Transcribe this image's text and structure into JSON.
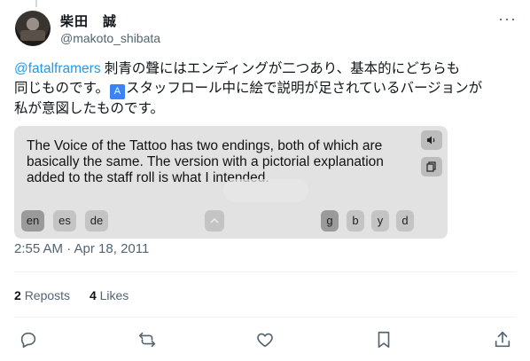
{
  "author": {
    "name": "柴田　誠",
    "handle": "@makoto_shibata"
  },
  "tweet": {
    "mention": "@fatalframers",
    "text_line1": " 刺青の聲にはエンディングが二つあり、基本的にどちらも",
    "text_line2a": "同じものです。",
    "text_line2b": "スタッフロール中に絵で説明が足されているバージョンが",
    "text_line3": "私が意図したものです。"
  },
  "translation": {
    "text": "The Voice of the Tattoo has two endings, both of which are basically the same. The version with a pictorial explanation added to the staff roll is what I intended.",
    "languages": [
      "en",
      "es",
      "de"
    ],
    "active_language": "en",
    "engines": [
      "g",
      "b",
      "y",
      "d"
    ],
    "active_engine": "g",
    "speak_icon": "speaker-icon",
    "copy_icon": "copy-icon",
    "collapse_icon": "chevron-up-icon"
  },
  "meta": {
    "timestamp": "2:55 AM · Apr 18, 2011"
  },
  "stats": {
    "reposts_count": "2",
    "reposts_label": "Reposts",
    "likes_count": "4",
    "likes_label": "Likes"
  },
  "actions": [
    "reply-icon",
    "repost-icon",
    "like-icon",
    "bookmark-icon",
    "share-icon"
  ],
  "colors": {
    "accent": "#1d9bf0",
    "secondary_text": "#536471",
    "translate_bg": "#e2e2e2"
  }
}
